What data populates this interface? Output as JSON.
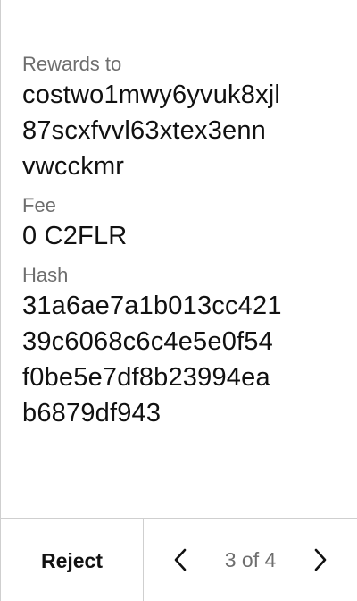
{
  "details": {
    "rewards_label": "Rewards to",
    "rewards_lines": [
      "costwo1mwy6yvuk8xjl",
      "87scxfvvl63xtex3enn",
      "vwcckmr"
    ],
    "fee_label": "Fee",
    "fee_value": "0 C2FLR",
    "hash_label": "Hash",
    "hash_lines": [
      "31a6ae7a1b013cc421",
      "39c6068c6c4e5e0f54",
      "f0be5e7df8b23994ea",
      "b6879df943"
    ]
  },
  "footer": {
    "reject_label": "Reject",
    "pager_text": "3 of 4",
    "prev_icon": "chevron-left-icon",
    "next_icon": "chevron-right-icon"
  }
}
